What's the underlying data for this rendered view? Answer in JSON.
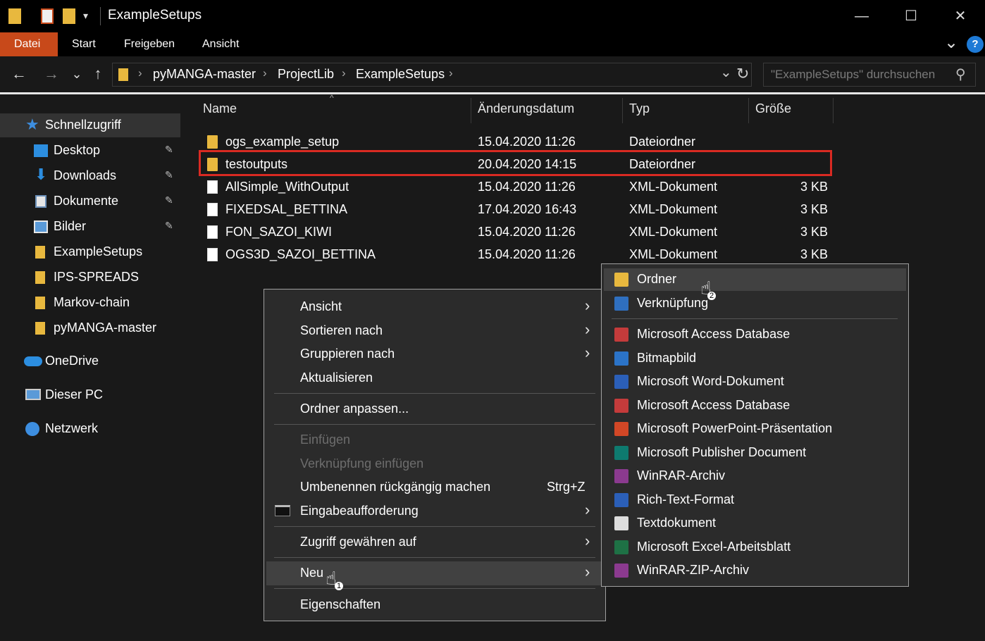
{
  "window": {
    "title": "ExampleSetups",
    "min_glyph": "—",
    "max_glyph": "☐",
    "close_glyph": "✕"
  },
  "ribbon": {
    "tabs": [
      "Datei",
      "Start",
      "Freigeben",
      "Ansicht"
    ],
    "help_glyph": "?",
    "expand_glyph": "⌄"
  },
  "nav": {
    "back": "←",
    "forward": "→",
    "recent": "⌄",
    "up": "↑",
    "breadcrumb": [
      "pyMANGA-master",
      "ProjectLib",
      "ExampleSetups"
    ],
    "sep": "›",
    "refresh": "↻",
    "dropdown": "⌄",
    "search_placeholder": "\"ExampleSetups\" durchsuchen",
    "search_glyph": "⚲"
  },
  "sidebar": {
    "items": [
      {
        "label": "Schnellzugriff",
        "icon": "star-icon"
      },
      {
        "label": "Desktop",
        "icon": "desktop-icon",
        "pinned": true
      },
      {
        "label": "Downloads",
        "icon": "download-icon",
        "pinned": true
      },
      {
        "label": "Dokumente",
        "icon": "document-icon",
        "pinned": true
      },
      {
        "label": "Bilder",
        "icon": "pictures-icon",
        "pinned": true
      },
      {
        "label": "ExampleSetups",
        "icon": "folder-icon"
      },
      {
        "label": "IPS-SPREADS",
        "icon": "folder-icon"
      },
      {
        "label": "Markov-chain",
        "icon": "folder-icon"
      },
      {
        "label": "pyMANGA-master",
        "icon": "folder-icon"
      },
      {
        "label": "OneDrive",
        "icon": "cloud-icon"
      },
      {
        "label": "Dieser PC",
        "icon": "computer-icon"
      },
      {
        "label": "Netzwerk",
        "icon": "network-icon"
      }
    ],
    "pin_glyph": "📌"
  },
  "filelist": {
    "columns": [
      "Name",
      "Änderungsdatum",
      "Typ",
      "Größe"
    ],
    "rows": [
      {
        "name": "ogs_example_setup",
        "date": "15.04.2020 11:26",
        "type": "Dateiordner",
        "size": "",
        "kind": "folder"
      },
      {
        "name": "testoutputs",
        "date": "20.04.2020 14:15",
        "type": "Dateiordner",
        "size": "",
        "kind": "folder"
      },
      {
        "name": "AllSimple_WithOutput",
        "date": "15.04.2020 11:26",
        "type": "XML-Dokument",
        "size": "3 KB",
        "kind": "file"
      },
      {
        "name": "FIXEDSAL_BETTINA",
        "date": "17.04.2020 16:43",
        "type": "XML-Dokument",
        "size": "3 KB",
        "kind": "file"
      },
      {
        "name": "FON_SAZOI_KIWI",
        "date": "15.04.2020 11:26",
        "type": "XML-Dokument",
        "size": "3 KB",
        "kind": "file"
      },
      {
        "name": "OGS3D_SAZOI_BETTINA",
        "date": "15.04.2020 11:26",
        "type": "XML-Dokument",
        "size": "3 KB",
        "kind": "file"
      }
    ]
  },
  "context_menu": {
    "items": [
      {
        "label": "Ansicht",
        "submenu": true
      },
      {
        "label": "Sortieren nach",
        "submenu": true
      },
      {
        "label": "Gruppieren nach",
        "submenu": true
      },
      {
        "label": "Aktualisieren"
      },
      {
        "label": "Ordner anpassen..."
      },
      {
        "label": "Einfügen",
        "disabled": true
      },
      {
        "label": "Verknüpfung einfügen",
        "disabled": true
      },
      {
        "label": "Umbenennen rückgängig machen",
        "shortcut": "Strg+Z"
      },
      {
        "label": "Eingabeaufforderung",
        "submenu": true
      },
      {
        "label": "Zugriff gewähren auf",
        "submenu": true
      },
      {
        "label": "Neu",
        "submenu": true,
        "hover": true
      },
      {
        "label": "Eigenschaften"
      }
    ],
    "arrow_glyph": "›"
  },
  "submenu": {
    "items": [
      {
        "label": "Ordner",
        "color": "#e8b83e"
      },
      {
        "label": "Verknüpfung",
        "color": "#2f6fbf"
      },
      {
        "label": "Microsoft Access Database",
        "color": "#c43b3b"
      },
      {
        "label": "Bitmapbild",
        "color": "#2b73c7"
      },
      {
        "label": "Microsoft Word-Dokument",
        "color": "#2b5fb8"
      },
      {
        "label": "Microsoft Access Database",
        "color": "#c43b3b"
      },
      {
        "label": "Microsoft PowerPoint-Präsentation",
        "color": "#d24726"
      },
      {
        "label": "Microsoft Publisher Document",
        "color": "#0e7a6f"
      },
      {
        "label": "WinRAR-Archiv",
        "color": "#8b3a8f"
      },
      {
        "label": "Rich-Text-Format",
        "color": "#2b5fb8"
      },
      {
        "label": "Textdokument",
        "color": "#dddddd"
      },
      {
        "label": "Microsoft Excel-Arbeitsblatt",
        "color": "#1e7145"
      },
      {
        "label": "WinRAR-ZIP-Archiv",
        "color": "#8b3a8f"
      }
    ]
  },
  "cursors": {
    "glyph": "☝",
    "step1": "1",
    "step2": "2"
  },
  "colors": {
    "accent_tab": "#c8491a",
    "highlight": "#d92a22"
  }
}
